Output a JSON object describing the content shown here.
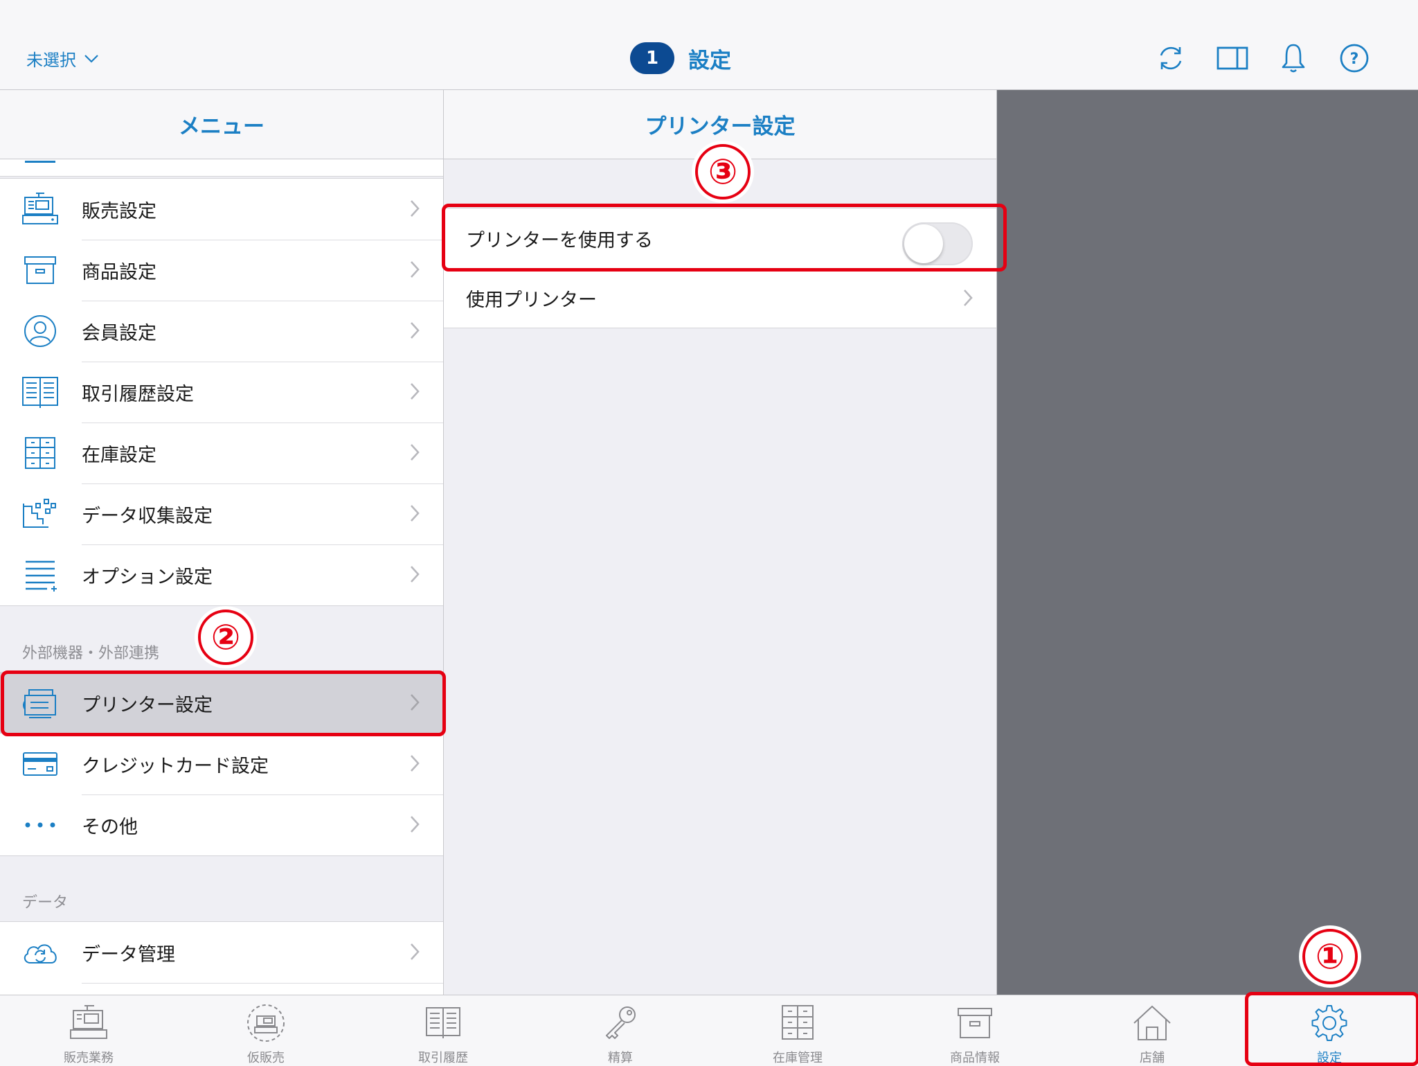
{
  "header": {
    "store_selector": "未選択",
    "badge": "1",
    "title": "設定"
  },
  "menu": {
    "title": "メニュー",
    "items": [
      {
        "label": "販売設定",
        "icon": "register-icon"
      },
      {
        "label": "商品設定",
        "icon": "box-icon"
      },
      {
        "label": "会員設定",
        "icon": "member-icon"
      },
      {
        "label": "取引履歴設定",
        "icon": "ledger-icon"
      },
      {
        "label": "在庫設定",
        "icon": "cabinet-icon"
      },
      {
        "label": "データ収集設定",
        "icon": "data-collect-icon"
      },
      {
        "label": "オプション設定",
        "icon": "option-list-icon"
      }
    ],
    "external_section_title": "外部機器・外部連携",
    "external_items": [
      {
        "label": "プリンター設定",
        "icon": "printer-icon",
        "selected": true
      },
      {
        "label": "クレジットカード設定",
        "icon": "credit-card-icon"
      },
      {
        "label": "その他",
        "icon": "more-dots-icon"
      }
    ],
    "data_section_title": "データ",
    "data_items": [
      {
        "label": "データ管理",
        "icon": "cloud-sync-icon"
      }
    ]
  },
  "printer_settings": {
    "title": "プリンター設定",
    "use_printer_label": "プリンターを使用する",
    "use_printer_enabled": false,
    "printer_select_label": "使用プリンター"
  },
  "tabs": [
    {
      "label": "販売業務",
      "icon": "register-icon"
    },
    {
      "label": "仮販売",
      "icon": "temp-sale-icon"
    },
    {
      "label": "取引履歴",
      "icon": "ledger-icon"
    },
    {
      "label": "精算",
      "icon": "key-icon"
    },
    {
      "label": "在庫管理",
      "icon": "cabinet-icon"
    },
    {
      "label": "商品情報",
      "icon": "box-icon"
    },
    {
      "label": "店舗",
      "icon": "house-icon"
    },
    {
      "label": "設定",
      "icon": "gear-icon",
      "active": true
    }
  ],
  "annotations": [
    "①",
    "②",
    "③"
  ],
  "colors": {
    "accent": "#1b7fc4",
    "badge": "#0c4a92",
    "highlight_red": "#e60012",
    "detail_pane": "#6e7077"
  }
}
